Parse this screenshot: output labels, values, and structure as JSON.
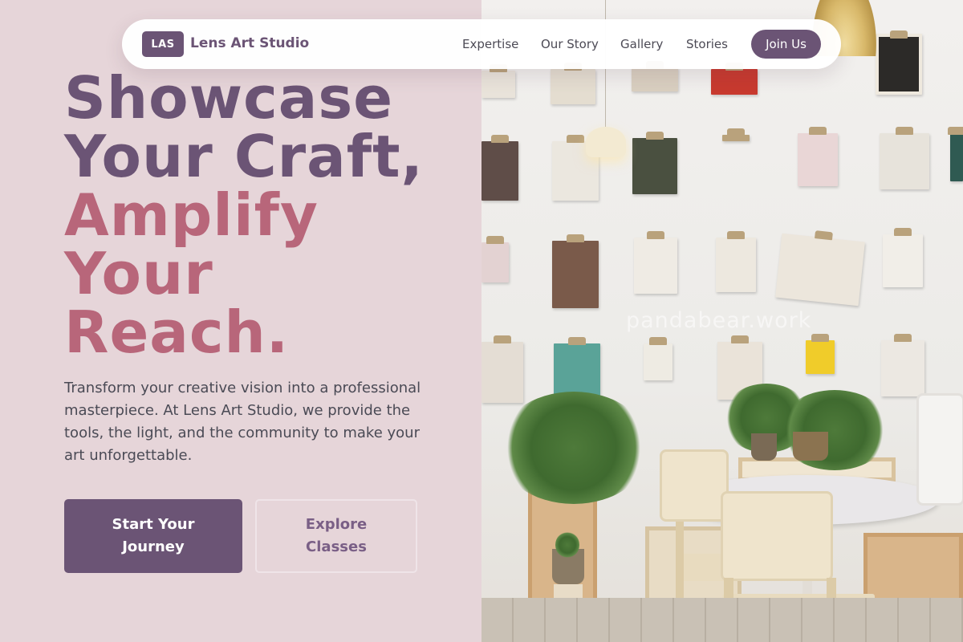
{
  "nav": {
    "logo_badge": "LAS",
    "brand": "Lens Art Studio",
    "links": [
      "Expertise",
      "Our Story",
      "Gallery",
      "Stories"
    ],
    "cta": "Join Us"
  },
  "hero": {
    "headline_lines": [
      "Showcase",
      "Your Craft,",
      "Amplify",
      "Your",
      "Reach."
    ],
    "description": "Transform your creative vision into a professional masterpiece. At Lens Art Studio, we provide the tools, the light, and the community to make your art unforgettable.",
    "primary_button": "Start Your Journey",
    "secondary_button": "Explore Classes"
  },
  "image": {
    "watermark": "pandabear.work"
  },
  "colors": {
    "background": "#e6d5d9",
    "primary": "#6b5475",
    "accent": "#b8667a",
    "text": "#4a4a55"
  }
}
